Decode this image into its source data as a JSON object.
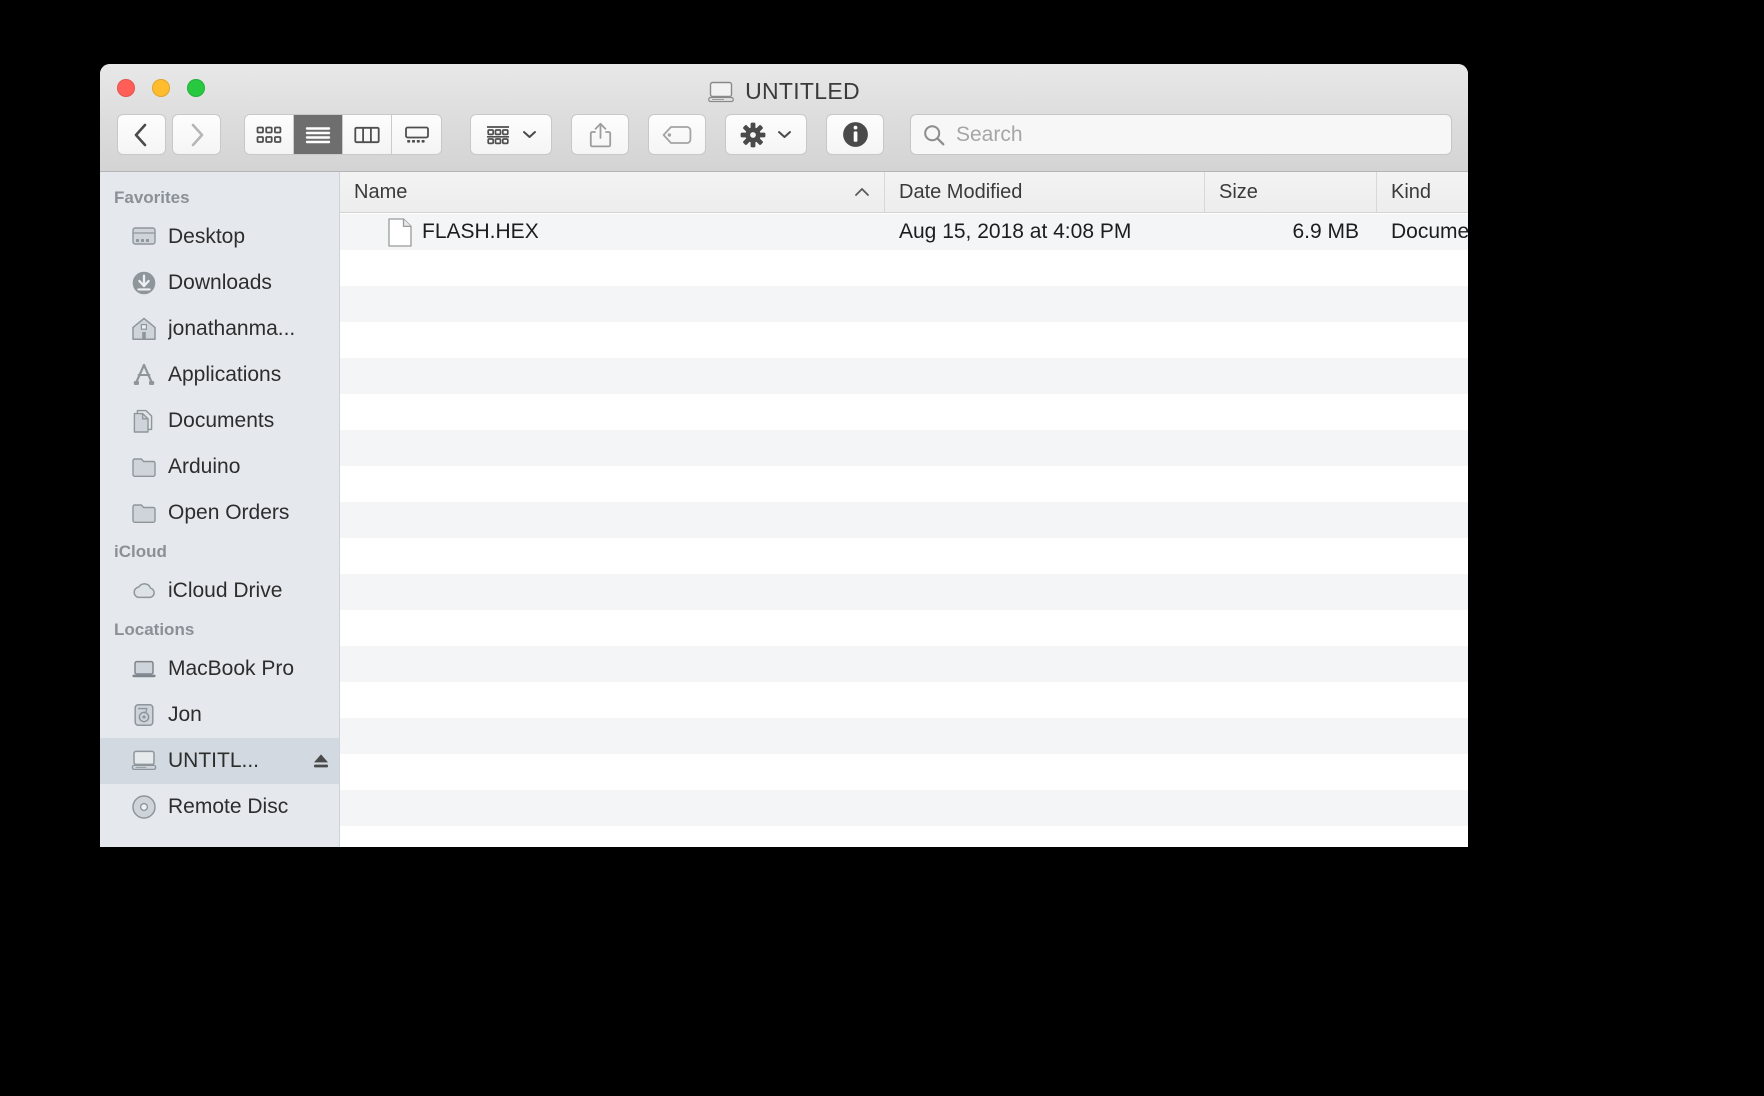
{
  "window": {
    "title": "UNTITLED",
    "title_icon": "drive-icon",
    "traffic_lights": [
      {
        "name": "close",
        "color": "#ff5f57"
      },
      {
        "name": "minimize",
        "color": "#febc2e"
      },
      {
        "name": "zoom",
        "color": "#28c840"
      }
    ]
  },
  "toolbar": {
    "back_icon": "chevron-left-icon",
    "forward_icon": "chevron-right-icon",
    "view_modes": [
      {
        "name": "icon-view",
        "icon": "grid-icon",
        "active": false
      },
      {
        "name": "list-view",
        "icon": "list-icon",
        "active": true
      },
      {
        "name": "column-view",
        "icon": "columns-icon",
        "active": false
      },
      {
        "name": "gallery-view",
        "icon": "gallery-icon",
        "active": false
      }
    ],
    "arrange_icon": "group-rows-icon",
    "share_icon": "share-icon",
    "tag_icon": "tag-icon",
    "action_icon": "gear-icon",
    "info_icon": "info-icon",
    "dropdown_icon": "chevron-down-icon"
  },
  "search": {
    "icon": "search-icon",
    "placeholder": "Search",
    "value": ""
  },
  "sidebar": {
    "sections": [
      {
        "header": "Favorites",
        "items": [
          {
            "label": "Desktop",
            "icon": "desktop-icon",
            "selected": false
          },
          {
            "label": "Downloads",
            "icon": "downloads-icon",
            "selected": false
          },
          {
            "label": "jonathanma...",
            "icon": "home-icon",
            "selected": false
          },
          {
            "label": "Applications",
            "icon": "applications-icon",
            "selected": false
          },
          {
            "label": "Documents",
            "icon": "documents-icon",
            "selected": false
          },
          {
            "label": "Arduino",
            "icon": "folder-icon",
            "selected": false
          },
          {
            "label": "Open Orders",
            "icon": "folder-icon",
            "selected": false
          }
        ]
      },
      {
        "header": "iCloud",
        "items": [
          {
            "label": "iCloud Drive",
            "icon": "cloud-icon",
            "selected": false
          }
        ]
      },
      {
        "header": "Locations",
        "items": [
          {
            "label": "MacBook Pro",
            "icon": "laptop-icon",
            "selected": false
          },
          {
            "label": "Jon",
            "icon": "harddisk-icon",
            "selected": false
          },
          {
            "label": "UNTITL...",
            "icon": "drive-icon",
            "selected": true,
            "eject": true
          },
          {
            "label": "Remote Disc",
            "icon": "disc-icon",
            "selected": false
          }
        ]
      }
    ]
  },
  "filelist": {
    "columns": [
      {
        "label": "Name",
        "sorted": true,
        "sort_direction": "asc"
      },
      {
        "label": "Date Modified",
        "sorted": false
      },
      {
        "label": "Size",
        "sorted": false
      },
      {
        "label": "Kind",
        "sorted": false
      }
    ],
    "rows": [
      {
        "name": "FLASH.HEX",
        "icon": "document-icon",
        "date_modified": "Aug 15, 2018 at 4:08 PM",
        "size": "6.9 MB",
        "kind": "Docume"
      }
    ],
    "empty_row_count": 17
  }
}
